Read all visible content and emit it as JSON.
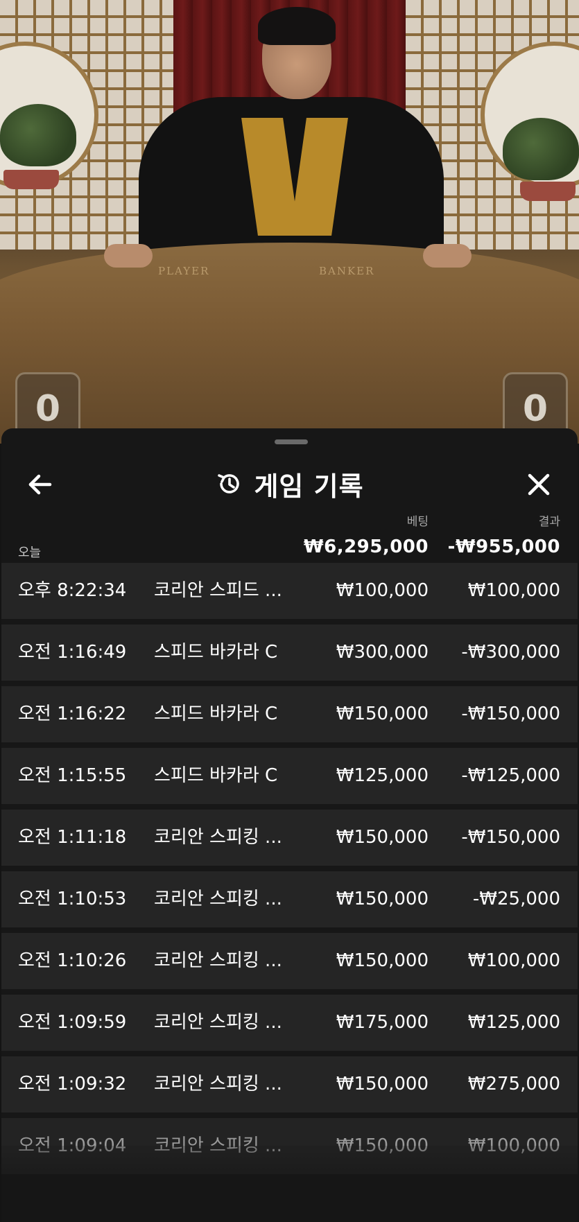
{
  "scene": {
    "felt_player_label": "PLAYER",
    "felt_banker_label": "BANKER",
    "player_score": "0",
    "banker_score": "0"
  },
  "sheet": {
    "title": "게임 기록",
    "icons": {
      "back": "arrow-left-icon",
      "history": "history-icon",
      "close": "close-icon"
    },
    "summary": {
      "day_label": "오늘",
      "bet_header": "베팅",
      "result_header": "결과",
      "total_bet": "₩6,295,000",
      "total_result": "-₩955,000"
    },
    "rows": [
      {
        "time": "오후 8:22:34",
        "game": "코리안 스피드 ...",
        "bet": "₩100,000",
        "result": "₩100,000"
      },
      {
        "time": "오전 1:16:49",
        "game": "스피드 바카라 C",
        "bet": "₩300,000",
        "result": "-₩300,000"
      },
      {
        "time": "오전 1:16:22",
        "game": "스피드 바카라 C",
        "bet": "₩150,000",
        "result": "-₩150,000"
      },
      {
        "time": "오전 1:15:55",
        "game": "스피드 바카라 C",
        "bet": "₩125,000",
        "result": "-₩125,000"
      },
      {
        "time": "오전 1:11:18",
        "game": "코리안 스피킹 ...",
        "bet": "₩150,000",
        "result": "-₩150,000"
      },
      {
        "time": "오전 1:10:53",
        "game": "코리안 스피킹 ...",
        "bet": "₩150,000",
        "result": "-₩25,000"
      },
      {
        "time": "오전 1:10:26",
        "game": "코리안 스피킹 ...",
        "bet": "₩150,000",
        "result": "₩100,000"
      },
      {
        "time": "오전 1:09:59",
        "game": "코리안 스피킹 ...",
        "bet": "₩175,000",
        "result": "₩125,000"
      },
      {
        "time": "오전 1:09:32",
        "game": "코리안 스피킹 ...",
        "bet": "₩150,000",
        "result": "₩275,000"
      },
      {
        "time": "오전 1:09:04",
        "game": "코리안 스피킹 ...",
        "bet": "₩150,000",
        "result": "₩100,000"
      }
    ]
  }
}
